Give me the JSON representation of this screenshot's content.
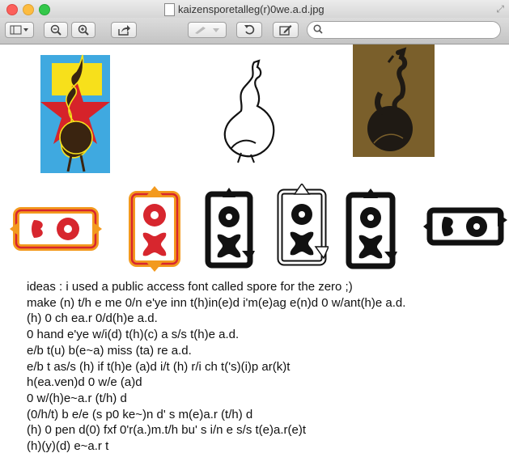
{
  "window": {
    "title": "kaizensporetalleg(r)0we.a.d.jpg"
  },
  "toolbar": {
    "search_placeholder": ""
  },
  "colors": {
    "sky_blue": "#3fa9e0",
    "star_red": "#d6232a",
    "yellow": "#f7e01b",
    "figure_brown": "#3a2410",
    "olive_bg": "#7a5f2b",
    "arrow_orange": "#f39a1e",
    "arrow_red": "#d7262e"
  },
  "notes": [
    "ideas : i used a public access font called spore for the zero ;)",
    "make (n) t/h e me 0/n e'ye inn t(h)in(e)d i'm(e)ag e(n)d 0 w/ant(h)e a.d.",
    "(h) 0 ch ea.r 0/d(h)e a.d.",
    "0 hand e'ye w/i(d) t(h)(c) a s/s t(h)e a.d.",
    "e/b t(u) b(e~a) miss (ta) re a.d.",
    "e/b t as/s (h) if t(h)e (a)d i/t (h) r/i ch t('s)(i)p ar(k)t",
    "h(ea.ven)d 0 w/e (a)d",
    "0 w/(h)e~a.r (t/h) d",
    "(0/h/t) b e/e (s p0 ke~)n d' s m(e)a.r (t/h) d",
    "(h) 0 pen d(0) fxf 0'r(a.)m.t/h bu' s i/n e s/s t(e)a.r(e)t",
    "(h)(y)(d) e~a.r t"
  ]
}
